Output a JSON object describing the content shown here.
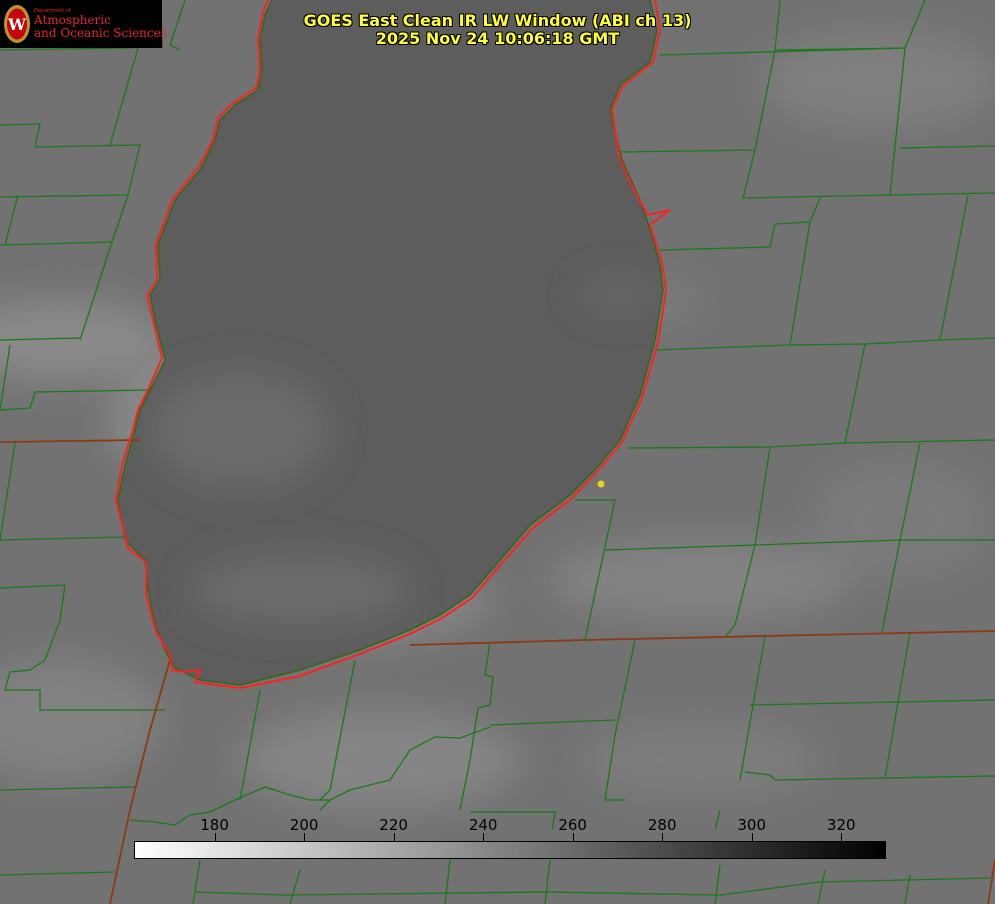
{
  "title": {
    "line1": "GOES East Clean IR LW Window (ABI ch 13)",
    "line2": "2025 Nov 24 10:06:18 GMT"
  },
  "logo": {
    "department": "Department of",
    "line1": "Atmospheric",
    "line2": "and Oceanic Sciences",
    "seal_letter": "W"
  },
  "colorbar": {
    "ticks": [
      "180",
      "200",
      "220",
      "240",
      "260",
      "280",
      "300",
      "320"
    ],
    "range": [
      162,
      330
    ],
    "gradient": [
      "#ffffff",
      "#000000"
    ]
  },
  "colors": {
    "county_lines": "#1a7a1a",
    "state_lines": "#8b3a14",
    "lake_outline": "#ff2020",
    "marker": "#e6d21e",
    "title_text": "#ffff33",
    "lake_fill": "#5a5a5a"
  },
  "map": {
    "feature": "lake",
    "marker_count": 1
  }
}
